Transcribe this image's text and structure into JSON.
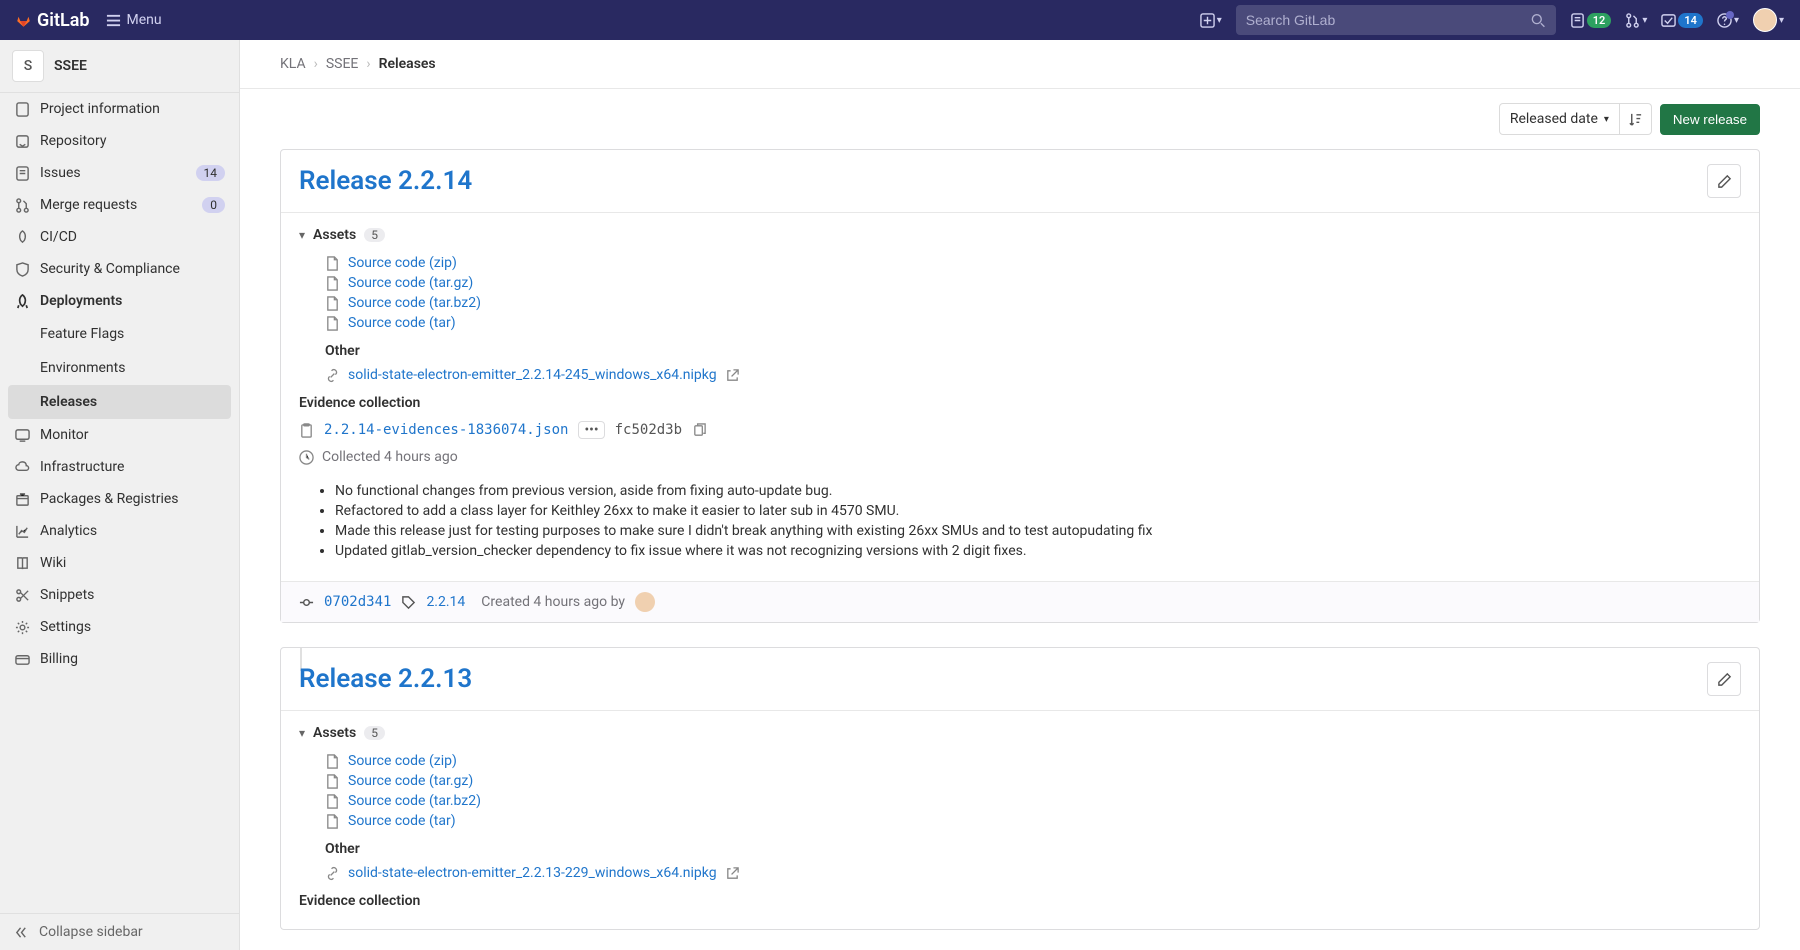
{
  "header": {
    "brand": "GitLab",
    "menu_label": "Menu",
    "search_placeholder": "Search GitLab",
    "issues_badge": "12",
    "todos_badge": "14"
  },
  "sidebar": {
    "project_initial": "S",
    "project_name": "SSEE",
    "items": [
      {
        "icon": "info",
        "label": "Project information"
      },
      {
        "icon": "repo",
        "label": "Repository"
      },
      {
        "icon": "issues",
        "label": "Issues",
        "badge": "14"
      },
      {
        "icon": "mr",
        "label": "Merge requests",
        "badge": "0"
      },
      {
        "icon": "cicd",
        "label": "CI/CD"
      },
      {
        "icon": "shield",
        "label": "Security & Compliance"
      },
      {
        "icon": "deploy",
        "label": "Deployments",
        "bold": true
      },
      {
        "sub": true,
        "label": "Feature Flags"
      },
      {
        "sub": true,
        "label": "Environments"
      },
      {
        "sub": true,
        "label": "Releases",
        "active": true
      },
      {
        "icon": "monitor",
        "label": "Monitor"
      },
      {
        "icon": "infra",
        "label": "Infrastructure"
      },
      {
        "icon": "pkg",
        "label": "Packages & Registries"
      },
      {
        "icon": "analytics",
        "label": "Analytics"
      },
      {
        "icon": "wiki",
        "label": "Wiki"
      },
      {
        "icon": "snippets",
        "label": "Snippets"
      },
      {
        "icon": "settings",
        "label": "Settings"
      },
      {
        "icon": "billing",
        "label": "Billing"
      }
    ],
    "collapse_label": "Collapse sidebar"
  },
  "breadcrumb": {
    "items": [
      "KLA",
      "SSEE",
      "Releases"
    ]
  },
  "controls": {
    "sort_by": "Released date",
    "new_release": "New release"
  },
  "releases": [
    {
      "title": "Release 2.2.14",
      "assets_label": "Assets",
      "assets_count": "5",
      "source_links": [
        "Source code (zip)",
        "Source code (tar.gz)",
        "Source code (tar.bz2)",
        "Source code (tar)"
      ],
      "other_label": "Other",
      "other_links": [
        "solid-state-electron-emitter_2.2.14-245_windows_x64.nipkg"
      ],
      "evidence_label": "Evidence collection",
      "evidence_file": "2.2.14-evidences-1836074.json",
      "evidence_sha": "fc502d3b",
      "collected_text": "Collected 4 hours ago",
      "notes": [
        "No functional changes from previous version, aside from fixing auto-update bug.",
        "Refactored to add a class layer for Keithley 26xx to make it easier to later sub in 4570 SMU.",
        "Made this release just for testing purposes to make sure I didn't break anything with existing 26xx SMUs and to test autopudating fix",
        "Updated gitlab_version_checker dependency to fix issue where it was not recognizing versions with 2 digit fixes."
      ],
      "footer": {
        "commit": "0702d341",
        "tag": "2.2.14",
        "created_text": "Created 4 hours ago by"
      }
    },
    {
      "title": "Release 2.2.13",
      "assets_label": "Assets",
      "assets_count": "5",
      "source_links": [
        "Source code (zip)",
        "Source code (tar.gz)",
        "Source code (tar.bz2)",
        "Source code (tar)"
      ],
      "other_label": "Other",
      "other_links": [
        "solid-state-electron-emitter_2.2.13-229_windows_x64.nipkg"
      ],
      "evidence_label": "Evidence collection"
    }
  ]
}
